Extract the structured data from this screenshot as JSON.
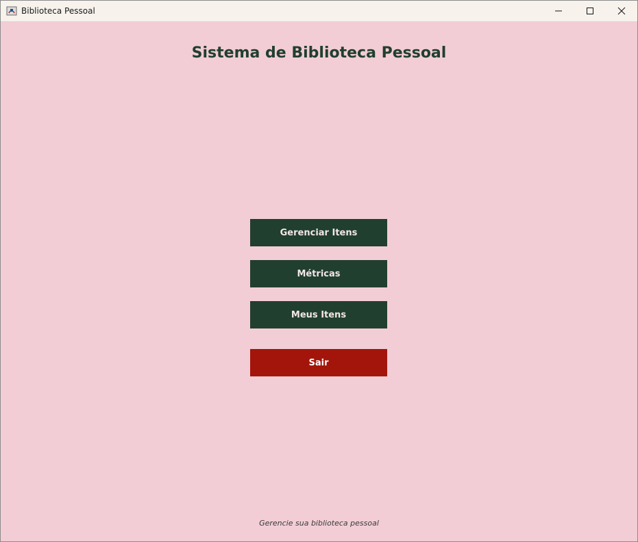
{
  "window": {
    "title": "Biblioteca Pessoal",
    "controls": {
      "minimize_icon": "minimize-icon",
      "maximize_icon": "maximize-icon",
      "close_icon": "close-icon"
    }
  },
  "main": {
    "title": "Sistema de Biblioteca Pessoal",
    "buttons": {
      "manage_items": "Gerenciar Itens",
      "metrics": "Métricas",
      "my_items": "Meus Itens",
      "exit": "Sair"
    },
    "footer": "Gerencie sua biblioteca pessoal"
  },
  "colors": {
    "background": "#f2cdd6",
    "primary_button": "#213f2e",
    "exit_button": "#a3150b",
    "title_text": "#213f2e"
  }
}
